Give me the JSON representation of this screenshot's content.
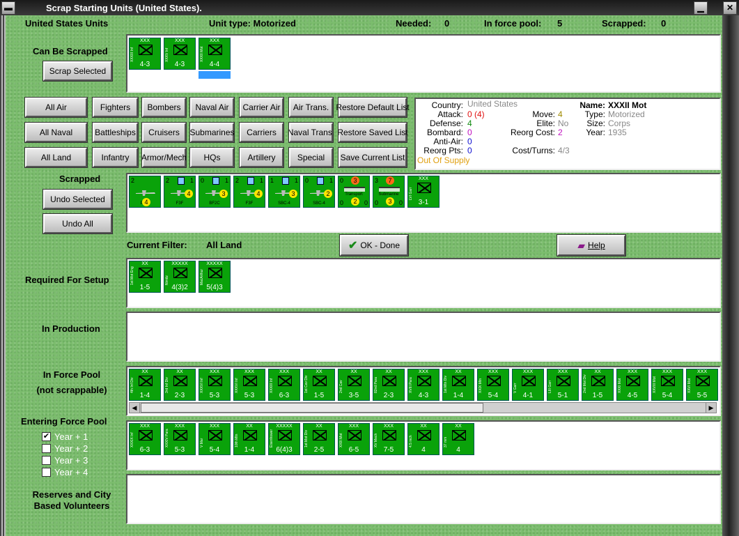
{
  "window": {
    "title": "Scrap Starting Units (United States)."
  },
  "header": {
    "units_label": "United States Units",
    "unit_type": "Unit type: Motorized",
    "needed_label": "Needed:",
    "needed_value": "0",
    "force_pool_label": "In force pool:",
    "force_pool_value": "5",
    "scrapped_label": "Scrapped:",
    "scrapped_value": "0"
  },
  "sections": {
    "can_be_scrapped": "Can Be Scrapped",
    "scrapped": "Scrapped",
    "current_filter_label": "Current Filter:",
    "current_filter_value": "All Land",
    "required_for_setup": "Required For Setup",
    "in_production": "In Production",
    "in_force_pool_1": "In Force Pool",
    "in_force_pool_2": "(not scrappable)",
    "entering_force_pool": "Entering Force Pool",
    "reserves_1": "Reserves and City",
    "reserves_2": "Based Volunteers"
  },
  "buttons": {
    "scrap_selected": "Scrap Selected",
    "undo_selected": "Undo Selected",
    "undo_all": "Undo All",
    "ok_done": "OK - Done",
    "help": "Help",
    "filters": [
      [
        "All Air",
        "Fighters",
        "Bombers",
        "Naval Air",
        "Carrier Air",
        "Air Trans.",
        "Restore Default List"
      ],
      [
        "All Naval",
        "Battleships",
        "Cruisers",
        "Submarines",
        "Carriers",
        "Naval Trans.",
        "Restore Saved List"
      ],
      [
        "All Land",
        "Infantry",
        "Armor/Mech",
        "HQs",
        "Artillery",
        "Special",
        "Save Current List"
      ]
    ]
  },
  "info": {
    "country_k": "Country:",
    "country_v": "United States",
    "attack_k": "Attack:",
    "attack_v": "0",
    "attack_v2": "(4)",
    "defense_k": "Defense:",
    "defense_v": "4",
    "bombard_k": "Bombard:",
    "bombard_v": "0",
    "antiair_k": "Anti-Air:",
    "antiair_v": "0",
    "reorg_pts_k": "Reorg Pts:",
    "reorg_pts_v": "0",
    "supply": "Out Of Supply",
    "move_k": "Move:",
    "move_v": "4",
    "elite_k": "Elite:",
    "elite_v": "No",
    "reorg_cost_k": "Reorg Cost:",
    "reorg_cost_v": "2",
    "cost_turns_k": "Cost/Turns:",
    "cost_turns_v": "4/3",
    "name_k": "Name:",
    "name_v": "XXXII Mot",
    "type_k": "Type:",
    "type_v": "Motorized",
    "size_k": "Size:",
    "size_v": "Corps",
    "year_k": "Year:",
    "year_v": "1935"
  },
  "units": {
    "can_be_scrapped": [
      {
        "size": "XXX",
        "name": "XXXIII Inf",
        "val": "4-3"
      },
      {
        "size": "XXX",
        "name": "XXXV Inf",
        "val": "4-3"
      },
      {
        "size": "XXX",
        "name": "XXXII Mot",
        "val": "4-4"
      }
    ],
    "scrapped_air": [
      {
        "tl": "2",
        "tr": "",
        "name": "P-26",
        "badge": "4"
      },
      {
        "tl": "2",
        "tr": "1",
        "name": "F3F",
        "badge": "4"
      },
      {
        "tl": "0",
        "tr": "1",
        "name": "BF2C",
        "badge": "3"
      },
      {
        "tl": "2",
        "tr": "1",
        "name": "F3F",
        "badge": "4"
      },
      {
        "tl": "1",
        "tr": "1",
        "name": "SBC-4",
        "badge": "3"
      },
      {
        "tl": "0",
        "tr": "1",
        "name": "SBC-4",
        "badge": "2"
      },
      {
        "tl": "0",
        "tr": "3",
        "name": "Transport",
        "bl": "0",
        "badge": "2",
        "br": "0"
      },
      {
        "tl": "3",
        "tr": "7",
        "name": "Submarine",
        "bl": "0",
        "badge": "3",
        "br": "0"
      }
    ],
    "scrapped_land": [
      {
        "size": "XXX",
        "name": "LVI Garr",
        "val": "3-1"
      }
    ],
    "required": [
      {
        "size": "XX",
        "name": "1st Mot Eng",
        "val": "1-5"
      },
      {
        "size": "XXXXX",
        "name": "Nimitz",
        "val": "4(3)2"
      },
      {
        "size": "XXXXX",
        "name": "MacArthur",
        "val": "5(4)3"
      }
    ],
    "force_pool": [
      {
        "size": "XX",
        "name": "4th Inf Div",
        "val": "1-4"
      },
      {
        "size": "XX",
        "name": "3rd Inf Div",
        "val": "2-3"
      },
      {
        "size": "XXX",
        "name": "XXXVI Inf",
        "val": "5-3"
      },
      {
        "size": "XXX",
        "name": "XXXVI Inf",
        "val": "5-3"
      },
      {
        "size": "XXX",
        "name": "XXXIII Inf",
        "val": "6-3"
      },
      {
        "size": "XX",
        "name": "1st Cav Div",
        "val": "1-5"
      },
      {
        "size": "XX",
        "name": "2nd Cav",
        "val": "3-5"
      },
      {
        "size": "XX",
        "name": "82nd Para",
        "val": "2-3"
      },
      {
        "size": "XXX",
        "name": "XVIII Para",
        "val": "4-3"
      },
      {
        "size": "XX",
        "name": "1st Mtn Div",
        "val": "1-4"
      },
      {
        "size": "XXX",
        "name": "XXIX Mtn",
        "val": "5-4"
      },
      {
        "size": "XXX",
        "name": "V Garr",
        "val": "4-1"
      },
      {
        "size": "XXX",
        "name": "LIII Garr",
        "val": "5-1"
      },
      {
        "size": "XX",
        "name": "2nd Mot Div",
        "val": "1-5"
      },
      {
        "size": "XXX",
        "name": "XXXI Mot",
        "val": "4-5"
      },
      {
        "size": "XXX",
        "name": "XXVIII Mot",
        "val": "5-4"
      },
      {
        "size": "XXX",
        "name": "XXVI Mot",
        "val": "5-5"
      }
    ],
    "entering": [
      {
        "size": "XXX",
        "name": "XXXIX Inf",
        "val": "6-3"
      },
      {
        "size": "XXX",
        "name": "XXXIV Para",
        "val": "5-3"
      },
      {
        "size": "XXX",
        "name": "V Mar",
        "val": "5-4"
      },
      {
        "size": "XX",
        "name": "10th Mtn",
        "val": "1-4"
      },
      {
        "size": "XXXXX",
        "name": "Eisenhower",
        "val": "6(4)3"
      },
      {
        "size": "XX",
        "name": "1st Mot Div",
        "val": "2-5"
      },
      {
        "size": "XXX",
        "name": "XXIII Mot",
        "val": "6-5"
      },
      {
        "size": "XXX",
        "name": "XV Mech",
        "val": "7-5"
      },
      {
        "size": "XX",
        "name": "4.5 inch",
        "val": "4"
      },
      {
        "size": "XX",
        "name": "37 mm",
        "val": "4"
      }
    ]
  },
  "years": [
    {
      "label": "Year + 1",
      "checked": true
    },
    {
      "label": "Year + 2",
      "checked": false
    },
    {
      "label": "Year + 3",
      "checked": false
    },
    {
      "label": "Year + 4",
      "checked": false
    }
  ]
}
